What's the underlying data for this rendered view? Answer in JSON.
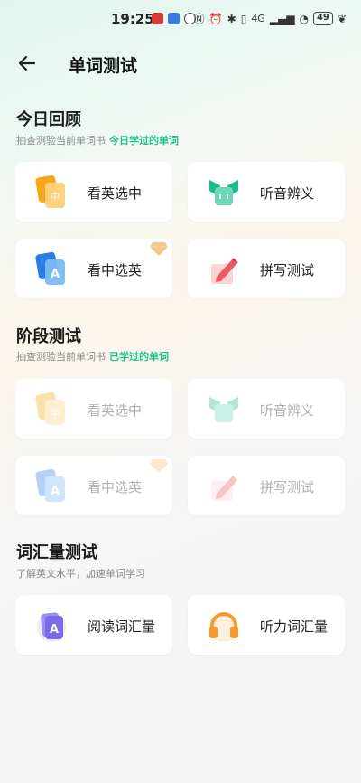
{
  "status": {
    "time": "25",
    "hour": "19",
    "battery": "49",
    "network": "4G"
  },
  "header": {
    "title": "单词测试"
  },
  "review": {
    "title": "今日回顾",
    "sub_prefix": "抽查测验当前单词书",
    "sub_highlight": "今日学过的单词",
    "cards": [
      "看英选中",
      "听音辨义",
      "看中选英",
      "拼写测试"
    ]
  },
  "stage": {
    "title": "阶段测试",
    "sub_prefix": "抽查测验当前单词书",
    "sub_highlight": "已学过的单词",
    "cards": [
      "看英选中",
      "听音辨义",
      "看中选英",
      "拼写测试"
    ]
  },
  "vocab": {
    "title": "词汇量测试",
    "sub": "了解英文水平，加速单词学习",
    "cards": [
      "阅读词汇量",
      "听力词汇量"
    ]
  },
  "icons": {
    "en_to_cn": "orange-cards-icon",
    "listen": "green-bow-icon",
    "cn_to_en": "blue-cards-icon",
    "spell": "red-pencil-icon",
    "reading": "purple-book-icon",
    "listening": "orange-headphones-icon",
    "premium": "diamond-icon"
  },
  "colors": {
    "accent": "#20c08a"
  }
}
